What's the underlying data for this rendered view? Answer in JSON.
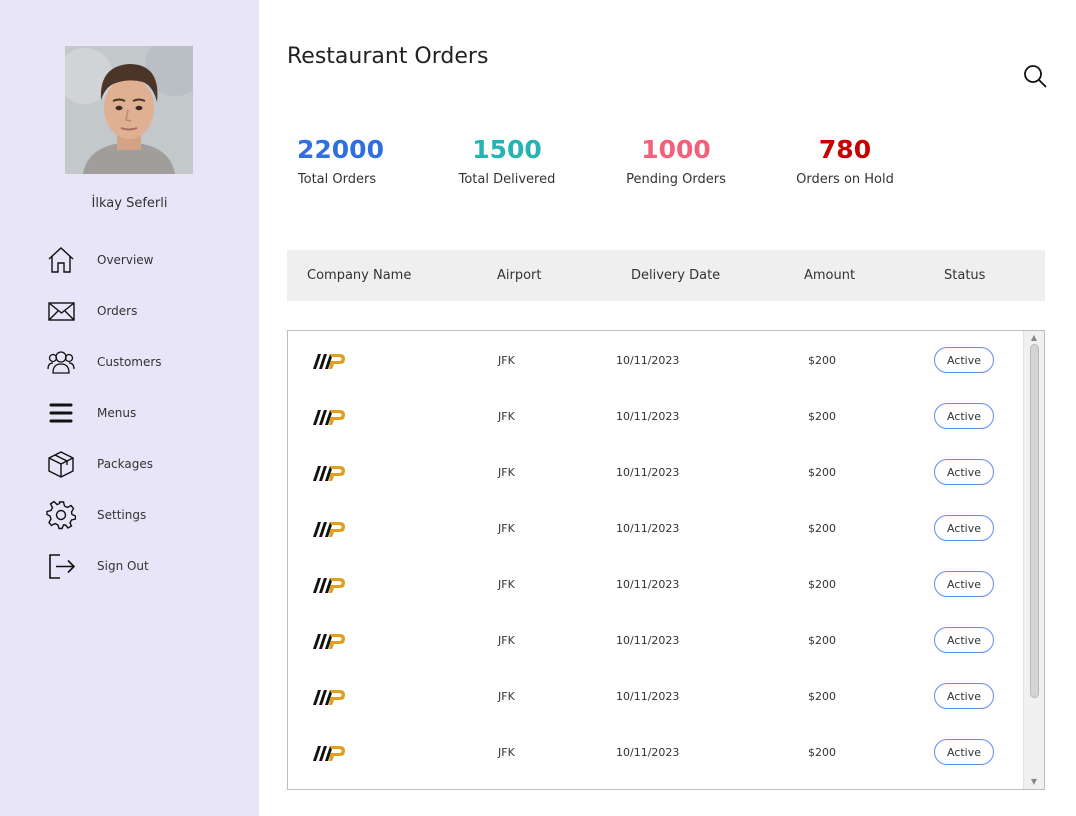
{
  "user": {
    "name": "İlkay Seferli"
  },
  "nav": [
    {
      "label": "Overview",
      "icon": "home-icon"
    },
    {
      "label": "Orders",
      "icon": "mail-icon"
    },
    {
      "label": "Customers",
      "icon": "customers-icon"
    },
    {
      "label": "Menus",
      "icon": "menu-icon"
    },
    {
      "label": "Packages",
      "icon": "package-icon"
    },
    {
      "label": "Settings",
      "icon": "gear-icon"
    },
    {
      "label": "Sign Out",
      "icon": "sign-out-icon"
    }
  ],
  "page": {
    "title": "Restaurant Orders"
  },
  "stats": [
    {
      "value": "22000",
      "label": "Total Orders",
      "color": "#2f6fe0"
    },
    {
      "value": "1500",
      "label": "Total Delivered",
      "color": "#26b3b3"
    },
    {
      "value": "1000",
      "label": "Pending Orders",
      "color": "#f2607a"
    },
    {
      "value": "780",
      "label": "Orders on Hold",
      "color": "#c80000"
    }
  ],
  "table": {
    "columns": [
      "Company Name",
      "Airport",
      "Delivery Date",
      "Amount",
      "Status"
    ],
    "rows": [
      {
        "airport": "JFK",
        "date": "10/11/2023",
        "amount": "$200",
        "status": "Active"
      },
      {
        "airport": "JFK",
        "date": "10/11/2023",
        "amount": "$200",
        "status": "Active"
      },
      {
        "airport": "JFK",
        "date": "10/11/2023",
        "amount": "$200",
        "status": "Active"
      },
      {
        "airport": "JFK",
        "date": "10/11/2023",
        "amount": "$200",
        "status": "Active"
      },
      {
        "airport": "JFK",
        "date": "10/11/2023",
        "amount": "$200",
        "status": "Active"
      },
      {
        "airport": "JFK",
        "date": "10/11/2023",
        "amount": "$200",
        "status": "Active"
      },
      {
        "airport": "JFK",
        "date": "10/11/2023",
        "amount": "$200",
        "status": "Active"
      },
      {
        "airport": "JFK",
        "date": "10/11/2023",
        "amount": "$200",
        "status": "Active"
      }
    ]
  },
  "colors": {
    "sidebar_bg": "#e8e5f8",
    "header_bg": "#efefef",
    "status_border": "#5b8def",
    "logo_gold": "#e0a020"
  }
}
